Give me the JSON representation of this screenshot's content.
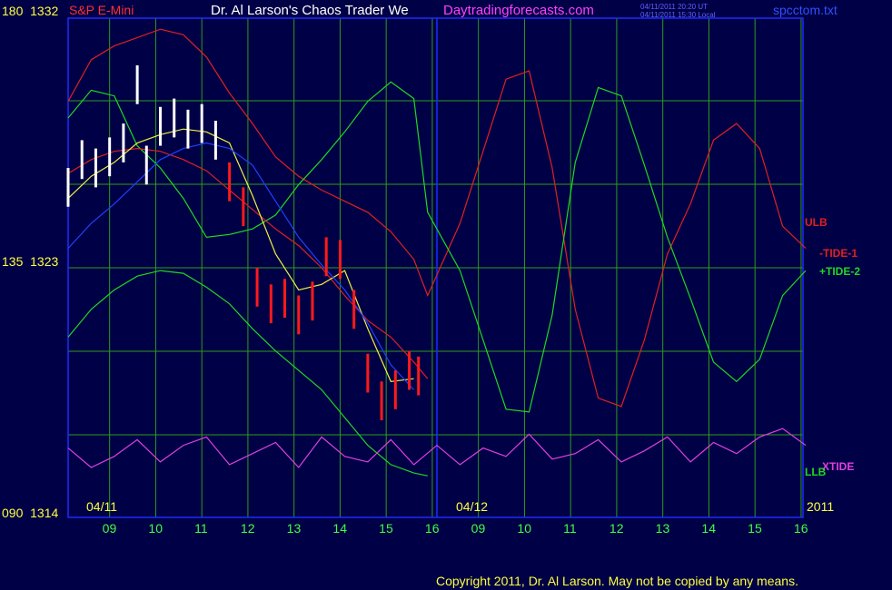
{
  "colors": {
    "background": "#000046",
    "plot_border": "#1e2aff",
    "grid": "#2f9c1a",
    "tide1": "#e02020",
    "tide2": "#20d820",
    "xtide": "#e040e0",
    "price": "#ffffff",
    "price_red": "#ff1a1a",
    "avg_yellow": "#f0f040",
    "avg_blue": "#2040ff",
    "title_red": "#ff3030",
    "title_white": "#ffffff",
    "title_magenta": "#ff40ff",
    "header_blue": "#6060ff",
    "axis_yellow": "#ffff40",
    "axis_green": "#40ff40",
    "footer_yellow": "#ffff40"
  },
  "header": {
    "instrument": "S&P E-Mini",
    "title": "Dr. Al Larson's Chaos Trader We",
    "website": "Daytradingforecasts.com",
    "timestamp_ut": "04/11/2011 20:20 UT",
    "timestamp_local": "04/11/2011 15:30 Local",
    "filename": "spcctom.txt"
  },
  "y_axis": {
    "top_label": "180  1332",
    "mid_label": "135  1323",
    "bottom_label": "090  1314"
  },
  "dates": {
    "day1": "04/11",
    "day2": "04/12",
    "year": "2011"
  },
  "footer": {
    "copyright": "Copyright 2011, Dr. Al Larson. May not be copied by any means."
  },
  "chart_data": {
    "type": "line",
    "title": "S&P E-Mini",
    "ylim": [
      1314,
      1332
    ],
    "angle_scale": [
      90,
      180
    ],
    "x_tick_labels": [
      "09",
      "10",
      "11",
      "12",
      "13",
      "14",
      "15",
      "16",
      "09",
      "10",
      "11",
      "12",
      "13",
      "14",
      "15",
      "16"
    ],
    "series_labels": [
      "ULB",
      "-TIDE-1",
      "+TIDE-2",
      "XTIDE",
      "LLB"
    ],
    "series": [
      {
        "name": "-TIDE-1",
        "note": "sampled at x = hours from 08:00 of 04/11 (day2 starts at 8.0)",
        "x": [
          0,
          0.5,
          1.0,
          1.5,
          2.0,
          2.5,
          3.0,
          3.5,
          4.0,
          4.5,
          5.0,
          5.5,
          6.0,
          6.5,
          7.0,
          7.5,
          7.8,
          8.5,
          9.0,
          9.5,
          10.0,
          10.5,
          11.0,
          11.5,
          12.0,
          12.5,
          13.0,
          13.5,
          14.0,
          14.5,
          15.0,
          15.5,
          16.0
        ],
        "values": [
          1329.0,
          1330.5,
          1331.0,
          1331.3,
          1331.6,
          1331.4,
          1330.6,
          1329.3,
          1328.2,
          1327.0,
          1326.3,
          1325.8,
          1325.4,
          1325.0,
          1324.3,
          1323.3,
          1322.0,
          1324.6,
          1327.2,
          1329.8,
          1330.1,
          1326.6,
          1321.5,
          1318.3,
          1318.0,
          1320.4,
          1323.5,
          1325.3,
          1327.6,
          1328.2,
          1327.3,
          1324.5,
          1323.7
        ]
      },
      {
        "name": "+TIDE-2",
        "x": [
          0,
          0.5,
          1.0,
          1.5,
          2.0,
          2.5,
          3.0,
          3.5,
          4.0,
          4.5,
          5.0,
          5.5,
          6.0,
          6.5,
          7.0,
          7.5,
          7.8,
          8.5,
          9.0,
          9.5,
          10.0,
          10.5,
          11.0,
          11.5,
          12.0,
          12.5,
          13.0,
          13.5,
          14.0,
          14.5,
          15.0,
          15.5,
          16.0
        ],
        "values": [
          1328.4,
          1329.4,
          1329.2,
          1327.4,
          1326.6,
          1325.5,
          1324.1,
          1324.2,
          1324.4,
          1324.9,
          1326.0,
          1326.9,
          1327.9,
          1329.0,
          1329.7,
          1329.1,
          1325.0,
          1322.9,
          1320.4,
          1317.9,
          1317.8,
          1321.3,
          1326.8,
          1329.5,
          1329.2,
          1326.7,
          1324.1,
          1321.9,
          1319.6,
          1318.9,
          1319.7,
          1322.0,
          1322.9
        ]
      },
      {
        "name": "ULB",
        "x": [
          0,
          0.5,
          1.0,
          1.5,
          2.0,
          2.5,
          3.0,
          3.5,
          4.0,
          4.5,
          5.0,
          5.5,
          6.0,
          6.5,
          7.0,
          7.5,
          7.8
        ],
        "values": [
          1326.4,
          1326.9,
          1327.2,
          1327.3,
          1327.2,
          1326.9,
          1326.5,
          1325.8,
          1325.1,
          1324.4,
          1323.8,
          1323.0,
          1322.0,
          1321.1,
          1320.5,
          1319.6,
          1319.0
        ]
      },
      {
        "name": "LLB",
        "x": [
          0,
          0.5,
          1.0,
          1.5,
          2.0,
          2.5,
          3.0,
          3.5,
          4.0,
          4.5,
          5.0,
          5.5,
          6.0,
          6.5,
          7.0,
          7.5,
          7.8
        ],
        "values": [
          1320.5,
          1321.5,
          1322.2,
          1322.7,
          1322.9,
          1322.8,
          1322.3,
          1321.7,
          1320.8,
          1320.0,
          1319.3,
          1318.6,
          1317.6,
          1316.6,
          1315.9,
          1315.6,
          1315.5
        ]
      },
      {
        "name": "XTIDE",
        "x": [
          0,
          0.5,
          1.0,
          1.5,
          2.0,
          2.5,
          3.0,
          3.5,
          4.0,
          4.5,
          5.0,
          5.5,
          6.0,
          6.5,
          7.0,
          7.5,
          8.0,
          8.5,
          9.0,
          9.5,
          10.0,
          10.5,
          11.0,
          11.5,
          12.0,
          12.5,
          13.0,
          13.5,
          14.0,
          14.5,
          15.0,
          15.5,
          16.0
        ],
        "values": [
          1316.5,
          1315.8,
          1316.2,
          1316.8,
          1316.0,
          1316.6,
          1316.9,
          1315.9,
          1316.3,
          1316.7,
          1315.8,
          1316.9,
          1316.2,
          1316.0,
          1316.8,
          1315.9,
          1316.6,
          1315.9,
          1316.5,
          1316.2,
          1317.0,
          1316.1,
          1316.3,
          1316.8,
          1316.0,
          1316.4,
          1316.9,
          1316.0,
          1316.7,
          1316.3,
          1316.9,
          1317.2,
          1316.6
        ]
      },
      {
        "name": "Price",
        "x": [
          0,
          0.3,
          0.6,
          0.9,
          1.2,
          1.5,
          1.7,
          2.0,
          2.3,
          2.6,
          2.9,
          3.2,
          3.5,
          3.8,
          4.1,
          4.4,
          4.7,
          5.0,
          5.3,
          5.6,
          5.9,
          6.2,
          6.5,
          6.8,
          7.1,
          7.4,
          7.6
        ],
        "values": [
          1325.9,
          1326.9,
          1326.6,
          1327.0,
          1327.5,
          1329.6,
          1326.7,
          1328.1,
          1328.4,
          1328.0,
          1328.2,
          1327.6,
          1326.1,
          1325.2,
          1322.3,
          1321.7,
          1321.9,
          1321.3,
          1321.8,
          1323.4,
          1323.3,
          1321.5,
          1319.2,
          1318.2,
          1318.6,
          1319.3,
          1319.1
        ]
      },
      {
        "name": "Moving average (yellow)",
        "x": [
          0,
          0.5,
          1.0,
          1.5,
          2.0,
          2.5,
          3.0,
          3.5,
          4.0,
          4.5,
          5.0,
          5.5,
          6.0,
          6.5,
          7.0,
          7.5
        ],
        "values": [
          1325.5,
          1326.3,
          1326.8,
          1327.5,
          1327.8,
          1328.0,
          1327.9,
          1327.5,
          1325.6,
          1323.5,
          1322.2,
          1322.4,
          1322.9,
          1320.8,
          1318.9,
          1319.0
        ]
      },
      {
        "name": "Moving average (blue)",
        "x": [
          0,
          0.5,
          1.0,
          1.5,
          2.0,
          2.5,
          3.0,
          3.5,
          4.0,
          4.5,
          5.0,
          5.5,
          6.0,
          6.5,
          7.0,
          7.5
        ],
        "values": [
          1323.7,
          1324.6,
          1325.3,
          1326.1,
          1326.9,
          1327.3,
          1327.5,
          1327.3,
          1326.7,
          1325.4,
          1324.1,
          1323.1,
          1322.2,
          1321.0,
          1319.5,
          1318.6
        ]
      }
    ]
  }
}
